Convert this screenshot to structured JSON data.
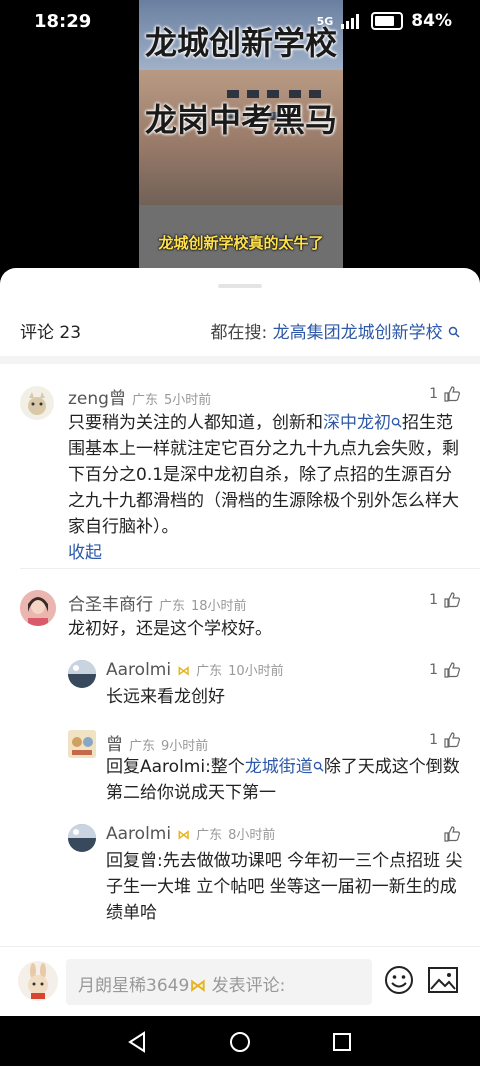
{
  "status_bar": {
    "time": "18:29",
    "network": "5G",
    "battery": "84%"
  },
  "video": {
    "title_line1": "龙城创新学校",
    "title_line2": "龙岗中考黑马",
    "subtitle": "龙城创新学校真的太牛了"
  },
  "comments_header": {
    "title": "评论 23",
    "search_prefix": "都在搜:",
    "search_term": "龙高集团龙城创新学校"
  },
  "comments": [
    {
      "user": "zeng曾",
      "region": "广东",
      "time": "5小时前",
      "likes": "1",
      "text_a": "只要稍为关注的人都知道，创新和",
      "link": "深中龙初",
      "text_b": "招生范围基本上一样就注定它百分之九十九点九会失败，剩下百分之0.1是深中龙初自杀，除了点招的生源百分之九十九都滑档的（滑档的生源除极个别外怎么样大家自行脑补）。",
      "collapse": "收起"
    },
    {
      "user": "合圣丰商行",
      "region": "广东",
      "time": "18小时前",
      "likes": "1",
      "text": "龙初好，还是这个学校好。"
    }
  ],
  "replies": [
    {
      "user": "Aarolmi",
      "region": "广东",
      "time": "10小时前",
      "likes": "1",
      "text": "长远来看龙创好"
    },
    {
      "user": "曾",
      "region": "广东",
      "time": "9小时前",
      "likes": "1",
      "text_a": "回复Aarolmi:整个",
      "link": "龙城街道",
      "text_b": "除了天成这个倒数第二给你说成天下第一"
    },
    {
      "user": "Aarolmi",
      "region": "广东",
      "time": "8小时前",
      "likes": "",
      "text": "回复曾:先去做做功课吧  今年初一三个点招班  尖子生一大堆  立个帖吧  坐等这一届初一新生的成绩单哈"
    }
  ],
  "bottom_bar": {
    "placeholder": "月朗星稀3649",
    "post_label": "发表评论:"
  },
  "colors": {
    "link": "#2d59a8",
    "accent_badge": "#e6b422"
  }
}
